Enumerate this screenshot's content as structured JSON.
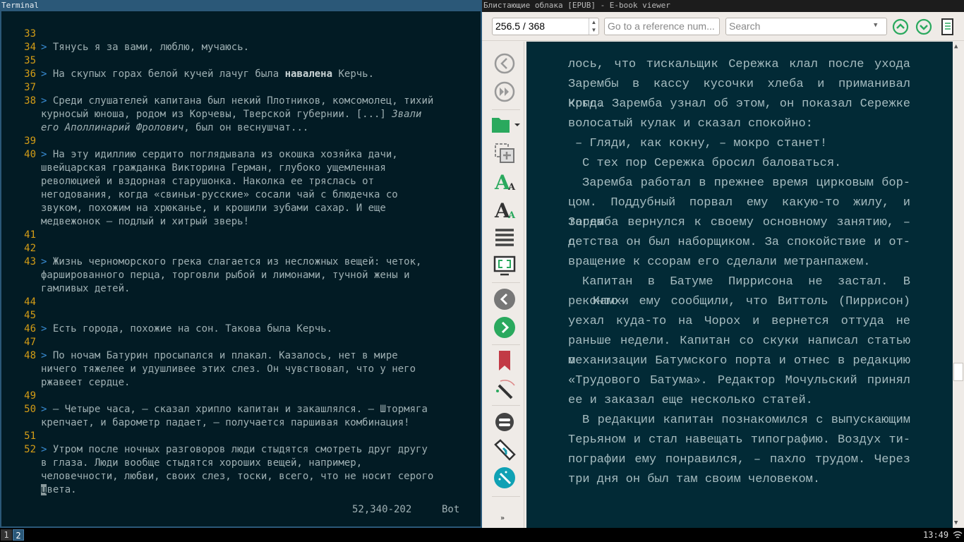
{
  "terminal": {
    "title": "Terminal",
    "lines": [
      {
        "n": "33",
        "rows": []
      },
      {
        "n": "34",
        "rows": [
          [
            [
              "gt",
              "> "
            ],
            [
              "",
              "Тянусь я за вами, люблю, мучаюсь."
            ]
          ]
        ]
      },
      {
        "n": "35",
        "rows": []
      },
      {
        "n": "36",
        "rows": [
          [
            [
              "gt",
              "> "
            ],
            [
              "",
              "На скупых горах белой кучей лачуг была "
            ],
            [
              "b",
              "навалена"
            ],
            [
              "",
              " Керчь."
            ]
          ]
        ]
      },
      {
        "n": "37",
        "rows": []
      },
      {
        "n": "38",
        "rows": [
          [
            [
              "gt",
              "> "
            ],
            [
              "",
              "Среди слушателей капитана был некий Плотников, комсомолец, тихий"
            ]
          ],
          [
            [
              "",
              "курносый юноша, родом из Корчевы, Тверской губернии. [...] "
            ],
            [
              "i",
              "Звали"
            ]
          ],
          [
            [
              "i",
              "его Аполлинарий Фролович"
            ],
            [
              "",
              ", был он веснушчат..."
            ]
          ]
        ]
      },
      {
        "n": "39",
        "rows": []
      },
      {
        "n": "40",
        "rows": [
          [
            [
              "gt",
              "> "
            ],
            [
              "",
              "На эту идиллию сердито поглядывала из окошка хозяйка дачи,"
            ]
          ],
          [
            [
              "",
              "швейцарская гражданка Викторина Герман, глубоко ущемленная"
            ]
          ],
          [
            [
              "",
              "революцией и вздорная старушонка. Наколка ее тряслась от"
            ]
          ],
          [
            [
              "",
              "негодования, когда «свиньи-русские» сосали чай с блюдечка со"
            ]
          ],
          [
            [
              "",
              "звуком, похожим на хрюканье, и крошили зубами сахар. И еще"
            ]
          ],
          [
            [
              "",
              "медвежонок – подлый и хитрый зверь!"
            ]
          ]
        ]
      },
      {
        "n": "41",
        "rows": []
      },
      {
        "n": "42",
        "rows": []
      },
      {
        "n": "43",
        "rows": [
          [
            [
              "gt",
              "> "
            ],
            [
              "",
              "Жизнь черноморского грека слагается из несложных вещей: четок,"
            ]
          ],
          [
            [
              "",
              "фаршированного перца, торговли рыбой и лимонами, тучной жены и"
            ]
          ],
          [
            [
              "",
              "гамливых детей."
            ]
          ]
        ]
      },
      {
        "n": "44",
        "rows": []
      },
      {
        "n": "45",
        "rows": []
      },
      {
        "n": "46",
        "rows": [
          [
            [
              "gt",
              "> "
            ],
            [
              "",
              "Есть города, похожие на сон. Такова была Керчь."
            ]
          ]
        ]
      },
      {
        "n": "47",
        "rows": []
      },
      {
        "n": "48",
        "rows": [
          [
            [
              "gt",
              "> "
            ],
            [
              "",
              "По ночам Батурин просыпался и плакал. Казалось, нет в мире"
            ]
          ],
          [
            [
              "",
              "ничего тяжелее и удушливее этих слез. Он чувствовал, что у него"
            ]
          ],
          [
            [
              "",
              "ржавеет сердце."
            ]
          ]
        ]
      },
      {
        "n": "49",
        "rows": []
      },
      {
        "n": "50",
        "rows": [
          [
            [
              "gt",
              "> "
            ],
            [
              "",
              "– Четыре часа, – сказал хрипло капитан и закашлялся. – Штормяга"
            ]
          ],
          [
            [
              "",
              "крепчает, и барометр падает, – получается паршивая комбинация!"
            ]
          ]
        ]
      },
      {
        "n": "51",
        "rows": []
      },
      {
        "n": "52",
        "rows": [
          [
            [
              "gt",
              "> "
            ],
            [
              "",
              "Утром после ночных разговоров люди стыдятся смотреть друг другу"
            ]
          ],
          [
            [
              "",
              "в глаза. Люди вообще стыдятся хороших вещей, например,"
            ]
          ],
          [
            [
              "",
              "человечности, любви, своих слез, тоски, всего, что не носит серого"
            ]
          ],
          [
            [
              "cursor",
              "ц"
            ],
            [
              "",
              "вета."
            ]
          ]
        ]
      }
    ],
    "position": "52,340-202",
    "scroll": "Bot"
  },
  "viewer": {
    "title": "Блистающие облака [EPUB] - E-book viewer",
    "page_value": "256.5 / 368",
    "reference_placeholder": "Go to a reference num...",
    "search_placeholder": "Search",
    "lines": [
      {
        "t": "лось, что тискальщик Сережка клал после ухода",
        "k": "j"
      },
      {
        "t": "Зарембы в кассу кусочки хлеба и приманивал крыс.",
        "k": "j"
      },
      {
        "t": "Когда Зарем­ба узнал об этом, он показал Сережке",
        "k": "j"
      },
      {
        "t": "волосатый кулак и сказал спокойно:",
        "k": ""
      },
      {
        "t": "– Гляди, как кокну, – мокро станет!",
        "k": "dash"
      },
      {
        "t": "С тех пор Сережка бросил баловаться.",
        "k": "ind"
      },
      {
        "t": "Зарем­ба работал в прежнее время цирковым бор-",
        "k": "ind j"
      },
      {
        "t": "цом. Поддубный порвал ему какую-то жилу, и тогда",
        "k": "j"
      },
      {
        "t": "Зарем­ба вернулся к своему основному занятию, – с",
        "k": "j"
      },
      {
        "t": "детства он был наборщиком. За спокойствие и от-",
        "k": "j"
      },
      {
        "t": "вращение к ссорам его сделали метранпажем.",
        "k": ""
      },
      {
        "t": "Капитан в Батуме Пиррисона не застал. В конто-",
        "k": "ind j"
      },
      {
        "t": "ре Камхи ему сообщили, что Виттоль (Пиррисон)",
        "k": "j"
      },
      {
        "t": "уехал куда-то на Чорох и вернется оттуда не",
        "k": "j"
      },
      {
        "t": "раньше недели. Капитан со скуки написал статью о",
        "k": "j"
      },
      {
        "t": "механизации Батумского порта и отнес в редакцию",
        "k": "j"
      },
      {
        "t": "«Трудового Батума». Редактор Мочульский принял",
        "k": "j"
      },
      {
        "t": "ее и заказал еще несколько статей.",
        "k": ""
      },
      {
        "t": "В редакции капитан познакомился с выпускающим",
        "k": "ind j"
      },
      {
        "t": "Терьяном и стал навещать типографию. Воздух ти-",
        "k": "j"
      },
      {
        "t": "пографии ему понравился, – пахло трудом. Через",
        "k": "j"
      },
      {
        "t": "три дня он был там своим человеком.",
        "k": ""
      }
    ]
  },
  "taskbar": {
    "workspaces": [
      "1",
      "2"
    ],
    "clock": "13:49"
  },
  "colors": {
    "accent_green": "#2aa95e",
    "bookmark_red": "#c23a45",
    "reader_bg": "#022a36"
  }
}
